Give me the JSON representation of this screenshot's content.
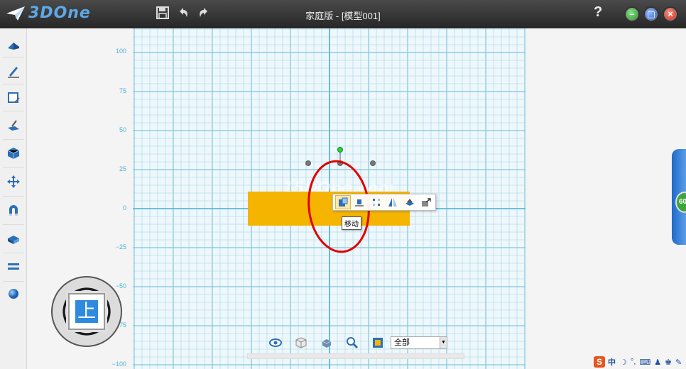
{
  "app": {
    "logo_text": "3DOne",
    "title": "家庭版 - [模型001]",
    "help": "?"
  },
  "colors": {
    "accent": "#2d8ae0",
    "grid": "#9fd6e6",
    "grid_major": "#7ec6dd",
    "axis": "#4ab3d6",
    "shape": "#f5b400",
    "annotation": "#e00000",
    "titlebar": "#2e2e2e"
  },
  "toolbar": {
    "save": "save-icon",
    "undo": "undo-icon",
    "redo": "redo-icon"
  },
  "window_buttons": [
    {
      "name": "minimize-button",
      "color": "#3aa63a"
    },
    {
      "name": "maximize-button",
      "color": "#2f6fd8"
    },
    {
      "name": "close-button",
      "color": "#e33b2e"
    }
  ],
  "left_tools": [
    "basic-solid-icon",
    "sketch-icon",
    "sketch-edit-icon",
    "feature-icon",
    "special-feature-icon",
    "basic-edit-icon",
    "combine-icon",
    "auto-snap-icon",
    "distance-measure-icon",
    "material-icon"
  ],
  "grid": {
    "y_labels": [
      "100",
      "75",
      "50",
      "25",
      "0",
      "−25",
      "−50",
      "−75",
      "−100"
    ]
  },
  "watermark": "15DOne.com",
  "nav_cube": {
    "face_label": "上"
  },
  "float_toolbar": {
    "items": [
      "move-icon",
      "align-icon",
      "pattern-icon",
      "mirror-icon",
      "dome-icon",
      "export-icon"
    ],
    "tooltip": "移动"
  },
  "bottom_bar": {
    "items": [
      "view-icon",
      "render-mode-icon",
      "display-icon",
      "zoom-icon",
      "filter-icon"
    ],
    "filter_value": "全部"
  },
  "right_badge": "60",
  "tray": {
    "ime_label": "中"
  }
}
